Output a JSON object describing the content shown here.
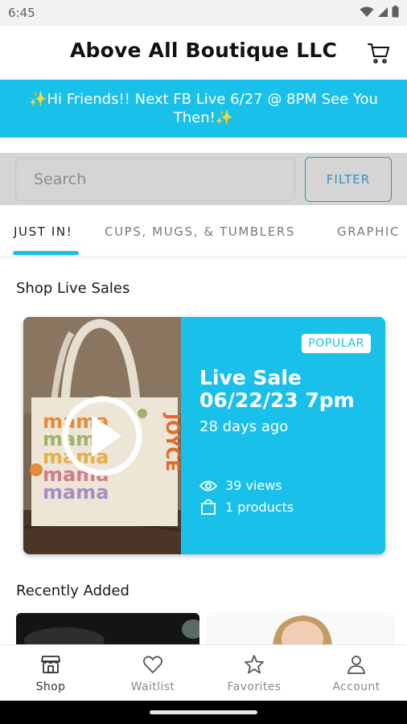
{
  "status_bar": {
    "time": "6:45"
  },
  "header": {
    "title": "Above All Boutique LLC"
  },
  "announcement": {
    "text": "✨Hi Friends!! Next FB Live 6/27 @ 8PM See You Then!✨"
  },
  "search": {
    "placeholder": "Search",
    "filter_label": "FILTER"
  },
  "tabs": [
    {
      "label": "JUST IN!",
      "active": true
    },
    {
      "label": "CUPS, MUGS, & TUMBLERS",
      "active": false
    },
    {
      "label": "GRAPHIC",
      "active": false
    }
  ],
  "live_sales": {
    "section_title": "Shop Live Sales",
    "card": {
      "badge": "POPULAR",
      "title_line1": "Live Sale",
      "title_line2": "06/22/23 7pm",
      "ago": "28 days ago",
      "views": "39 views",
      "products": "1 products",
      "bag_text": "JOYCE",
      "bag_words": [
        "mama",
        "mama",
        "mama",
        "mama",
        "mama"
      ]
    }
  },
  "recently_added": {
    "section_title": "Recently Added"
  },
  "bottom_nav": [
    {
      "label": "Shop",
      "icon": "storefront-icon",
      "active": true
    },
    {
      "label": "Waitlist",
      "icon": "heart-icon",
      "active": false
    },
    {
      "label": "Favorites",
      "icon": "star-icon",
      "active": false
    },
    {
      "label": "Account",
      "icon": "person-icon",
      "active": false
    }
  ],
  "colors": {
    "accent": "#19c0ea",
    "filter_border": "#3a8dba",
    "search_band": "#d5d5d5"
  }
}
